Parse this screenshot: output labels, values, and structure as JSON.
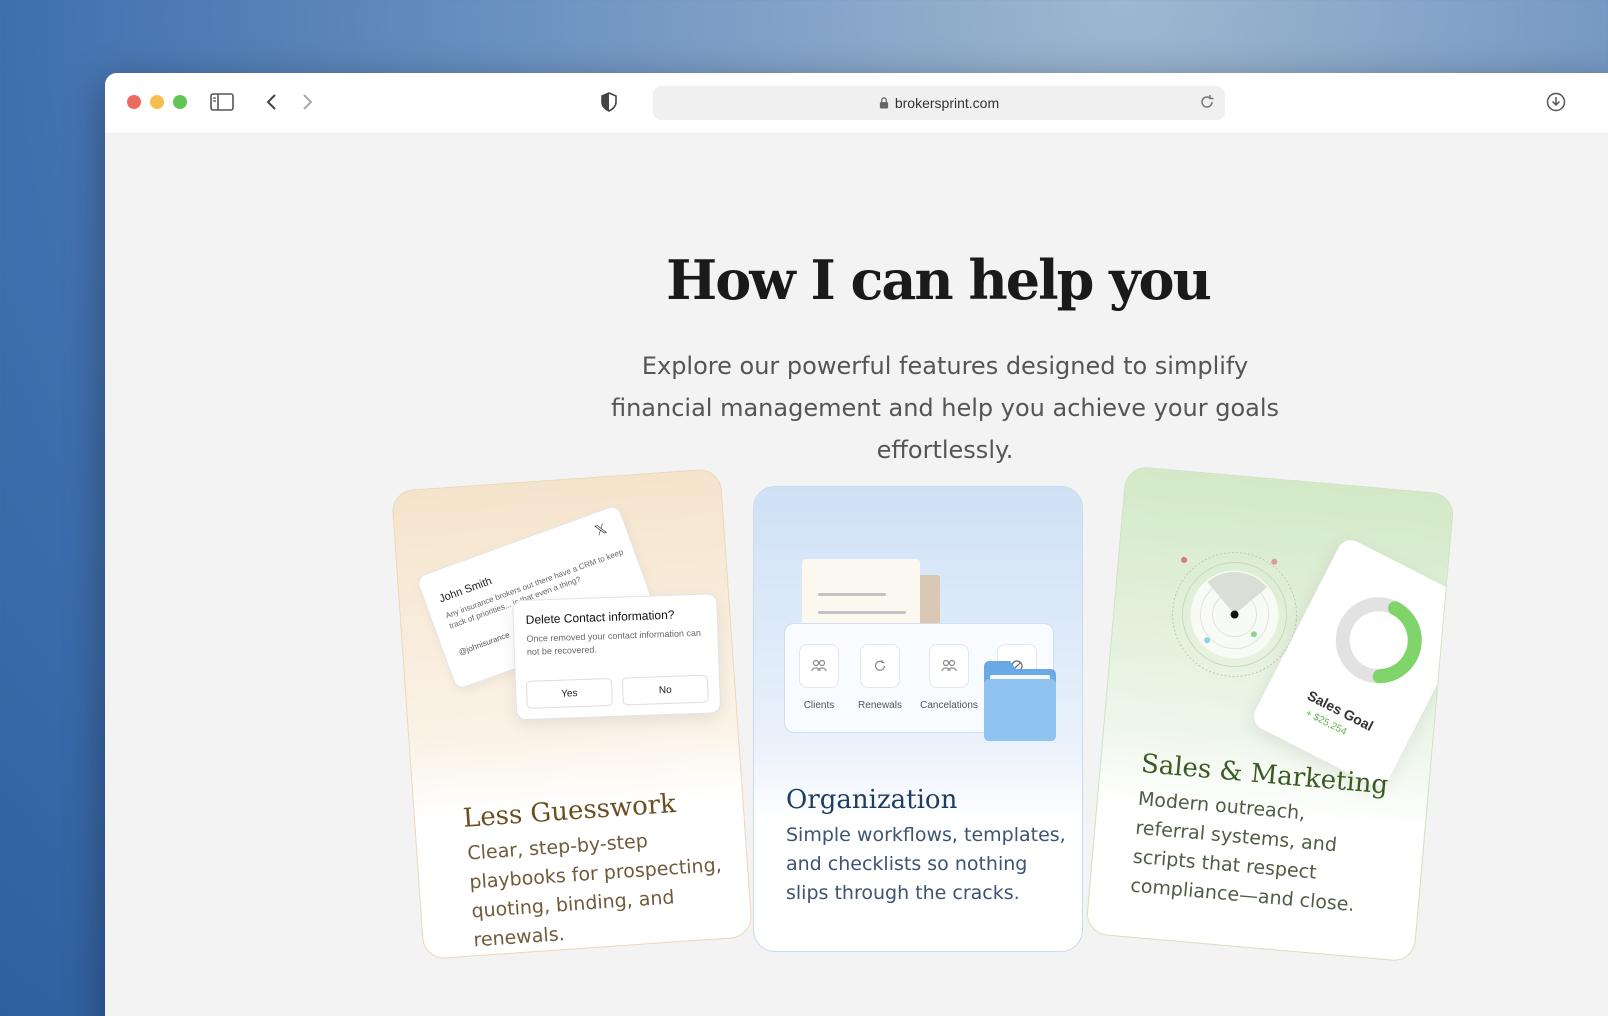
{
  "browser": {
    "url": "brokersprint.com"
  },
  "hero": {
    "title": "How I can help you",
    "subtitle": "Explore our powerful features designed to simplify financial management and help you achieve your goals effortlessly."
  },
  "cards": [
    {
      "title": "Less Guesswork",
      "text": "Clear, step-by-step playbooks for prospecting, quoting, binding, and renewals.",
      "tweet": {
        "name": "John Smith",
        "text": "Any insurance brokers out there have a CRM to keep track of priorities... is that even a thing?",
        "handle": "@johnisurance"
      },
      "dialog": {
        "title": "Delete Contact information?",
        "text": "Once removed your contact information can not be recovered.",
        "yes": "Yes",
        "no": "No"
      }
    },
    {
      "title": "Organization",
      "text": "Simple workflows, templates, and checklists so nothing slips through the cracks.",
      "tiles": [
        "Clients",
        "Renewals",
        "Cancelations"
      ]
    },
    {
      "title": "Sales & Marketing",
      "text": "Modern outreach, referral systems, and scripts that respect compliance—and close.",
      "goal": {
        "label": "Sales Goal",
        "value": "+ $25,254",
        "progress": 0.42
      }
    }
  ],
  "colors": {
    "accent_green": "#7fd46a",
    "accent_blue": "#8fc3f0",
    "warm": "#f5e4cc"
  }
}
